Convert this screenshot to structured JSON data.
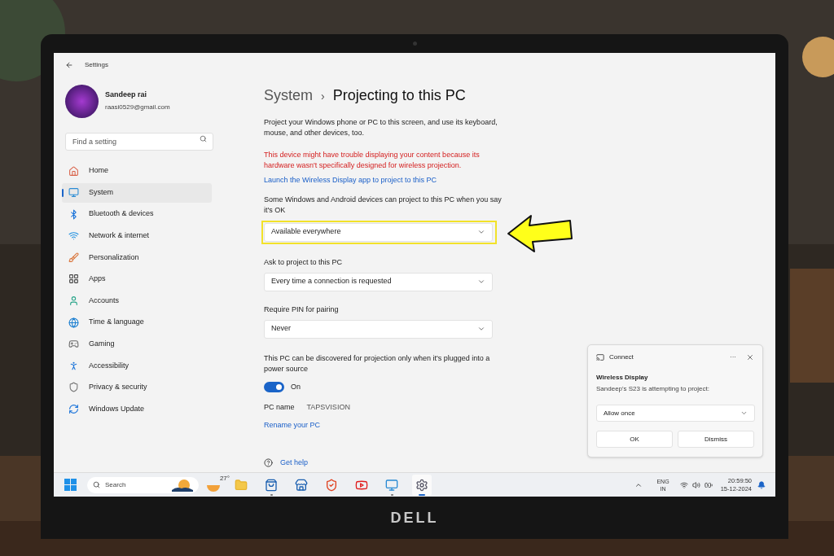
{
  "window": {
    "title": "Settings"
  },
  "profile": {
    "name": "Sandeep rai",
    "email": "raasi0529@gmail.com"
  },
  "search": {
    "placeholder": "Find a setting"
  },
  "nav": [
    {
      "label": "Home",
      "kind": "home",
      "selected": false
    },
    {
      "label": "System",
      "kind": "system",
      "selected": true
    },
    {
      "label": "Bluetooth & devices",
      "kind": "bluetooth",
      "selected": false
    },
    {
      "label": "Network & internet",
      "kind": "network",
      "selected": false
    },
    {
      "label": "Personalization",
      "kind": "brush",
      "selected": false
    },
    {
      "label": "Apps",
      "kind": "apps",
      "selected": false
    },
    {
      "label": "Accounts",
      "kind": "account",
      "selected": false
    },
    {
      "label": "Time & language",
      "kind": "time",
      "selected": false
    },
    {
      "label": "Gaming",
      "kind": "gaming",
      "selected": false
    },
    {
      "label": "Accessibility",
      "kind": "accessibility",
      "selected": false
    },
    {
      "label": "Privacy & security",
      "kind": "privacy",
      "selected": false
    },
    {
      "label": "Windows Update",
      "kind": "update",
      "selected": false
    }
  ],
  "breadcrumb": {
    "parent": "System",
    "separator": "›",
    "current": "Projecting to this PC"
  },
  "description": "Project your Windows phone or PC to this screen, and use its keyboard, mouse, and other devices, too.",
  "warning": "This device might have trouble displaying your content because its hardware wasn't specifically designed for wireless projection.",
  "launch_link": "Launch the Wireless Display app to project to this PC",
  "settings": [
    {
      "label": "Some Windows and Android devices can project to this PC when you say it's OK",
      "value": "Available everywhere",
      "highlighted": true
    },
    {
      "label": "Ask to project to this PC",
      "value": "Every time a connection is requested",
      "highlighted": false
    },
    {
      "label": "Require PIN for pairing",
      "value": "Never",
      "highlighted": false
    }
  ],
  "power": {
    "label": "This PC can be discovered for projection only when it's plugged into a power source",
    "on": true,
    "state_text": "On"
  },
  "pc_name": {
    "label": "PC name",
    "value": "TAPSVISION"
  },
  "rename_link": "Rename your PC",
  "get_help": "Get help",
  "notification": {
    "app": "Connect",
    "more": "···",
    "title": "Wireless Display",
    "message": "Sandeep's S23 is attempting to project:",
    "value": "Allow once",
    "buttons": [
      "OK",
      "Dismiss"
    ]
  },
  "taskbar": {
    "search": "Search",
    "weather": "27°",
    "apps": [
      {
        "kind": "files",
        "running": false,
        "selected": false
      },
      {
        "kind": "store",
        "running": true,
        "selected": false
      },
      {
        "kind": "store2",
        "running": false,
        "selected": false
      },
      {
        "kind": "brave",
        "running": false,
        "selected": false
      },
      {
        "kind": "youtube",
        "running": false,
        "selected": false
      },
      {
        "kind": "remote",
        "running": true,
        "selected": false
      },
      {
        "kind": "settings",
        "running": true,
        "selected": true
      }
    ],
    "language": "ENG",
    "region": "IN",
    "time": "20:59:50",
    "date": "15-12-2024"
  },
  "laptop": {
    "logo": "DELL"
  }
}
